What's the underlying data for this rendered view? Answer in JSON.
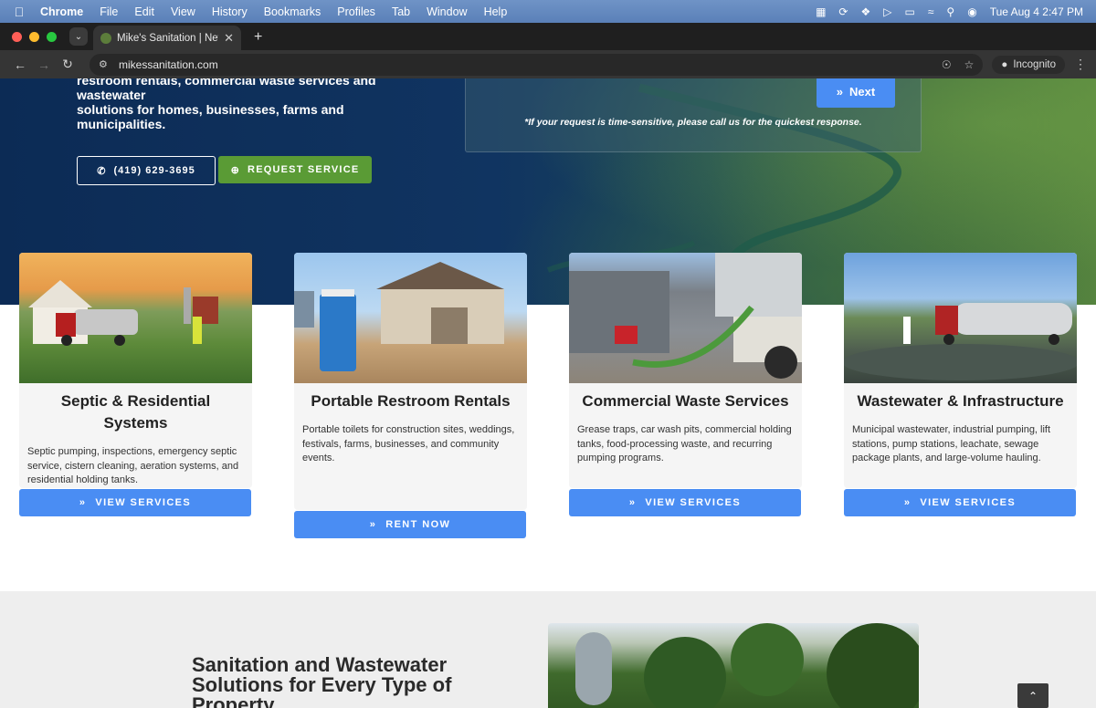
{
  "menubar": {
    "items": [
      "Chrome",
      "File",
      "Edit",
      "View",
      "History",
      "Bookmarks",
      "Profiles",
      "Tab",
      "Window",
      "Help"
    ],
    "clock": "Tue Aug 4  2:47 PM"
  },
  "browser": {
    "tab_title": "Mike's Sanitation | New Brem",
    "url": "mikessanitation.com",
    "incognito_label": "Incognito"
  },
  "hero": {
    "text_line1": "restroom rentals, commercial waste services and wastewater",
    "text_line2": "solutions for homes, businesses, farms and municipalities.",
    "phone_label": "(419) 629-3695",
    "request_label": "REQUEST SERVICE",
    "next_label": "Next",
    "note": "*If your request is time-sensitive, please call us for the quickest response."
  },
  "cards": [
    {
      "title": "Septic & Residential Systems",
      "desc": "Septic pumping, inspections, emergency septic service, cistern cleaning, aeration systems, and residential holding tanks.",
      "button": "VIEW SERVICES"
    },
    {
      "title": "Portable Restroom Rentals",
      "desc": "Portable toilets for construction sites, weddings, festivals, farms, businesses, and community events.",
      "button": "RENT NOW"
    },
    {
      "title": "Commercial Waste Services",
      "desc": "Grease traps, car wash pits, commercial holding tanks, food-processing waste, and recurring pumping programs.",
      "button": "VIEW SERVICES"
    },
    {
      "title": "Wastewater & Infrastructure",
      "desc": "Municipal wastewater, industrial pumping, lift stations, pump stations, leachate, sewage package plants, and large-volume hauling.",
      "button": "VIEW SERVICES"
    }
  ],
  "section2": {
    "title": "Sanitation and Wastewater Solutions for Every Type of Property"
  },
  "colors": {
    "hero_navy": "#0c2b55",
    "accent_blue": "#4a8df3",
    "accent_green": "#5a9b35"
  },
  "icons": [
    "apple-icon",
    "phone-icon",
    "plus-circle-icon",
    "double-chevron-icon",
    "chevron-up-icon"
  ]
}
